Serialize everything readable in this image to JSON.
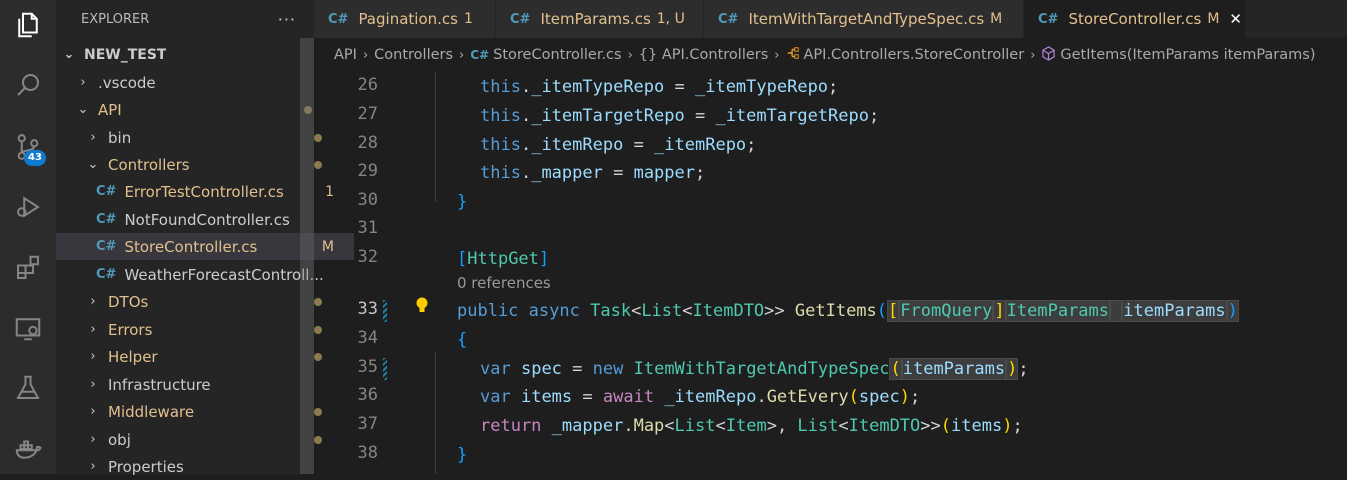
{
  "activity_bar": {
    "items": [
      {
        "name": "explorer",
        "icon": "files-icon"
      },
      {
        "name": "search",
        "icon": "search-icon"
      },
      {
        "name": "source-control",
        "icon": "source-control-icon",
        "badge": "43"
      },
      {
        "name": "run-debug",
        "icon": "debug-icon"
      },
      {
        "name": "extensions",
        "icon": "extensions-icon"
      },
      {
        "name": "remote-explorer",
        "icon": "remote-icon"
      },
      {
        "name": "testing",
        "icon": "flask-icon"
      },
      {
        "name": "docker",
        "icon": "docker-icon"
      }
    ]
  },
  "sidebar": {
    "title": "EXPLORER",
    "more": "···",
    "root": "NEW_TEST",
    "items": [
      {
        "label": ".vscode",
        "indent": 1,
        "type": "folder",
        "expanded": false
      },
      {
        "label": "API",
        "indent": 1,
        "type": "folder",
        "expanded": true,
        "modified": true
      },
      {
        "label": "bin",
        "indent": 2,
        "type": "folder",
        "expanded": false,
        "dot": true
      },
      {
        "label": "Controllers",
        "indent": 2,
        "type": "folder",
        "expanded": true,
        "modified": true
      },
      {
        "label": "ErrorTestController.cs",
        "indent": 3,
        "type": "file",
        "modified": true,
        "status": "1"
      },
      {
        "label": "NotFoundController.cs",
        "indent": 3,
        "type": "file"
      },
      {
        "label": "StoreController.cs",
        "indent": 3,
        "type": "file",
        "modified": true,
        "status": "M",
        "selected": true
      },
      {
        "label": "WeatherForecastControll...",
        "indent": 3,
        "type": "file"
      },
      {
        "label": "DTOs",
        "indent": 2,
        "type": "folder",
        "expanded": false,
        "modified": true
      },
      {
        "label": "Errors",
        "indent": 2,
        "type": "folder",
        "expanded": false,
        "modified": true
      },
      {
        "label": "Helper",
        "indent": 2,
        "type": "folder",
        "expanded": false,
        "modified": true
      },
      {
        "label": "Infrastructure",
        "indent": 2,
        "type": "folder",
        "expanded": false
      },
      {
        "label": "Middleware",
        "indent": 2,
        "type": "folder",
        "expanded": false,
        "modified": true
      },
      {
        "label": "obj",
        "indent": 2,
        "type": "folder",
        "expanded": false,
        "dot": true
      },
      {
        "label": "Properties",
        "indent": 2,
        "type": "folder",
        "expanded": false
      }
    ]
  },
  "tabs": [
    {
      "label": "Pagination.cs",
      "status": "1",
      "active": false
    },
    {
      "label": "ItemParams.cs",
      "status": "1, U",
      "active": false
    },
    {
      "label": "ItemWithTargetAndTypeSpec.cs",
      "status": "M",
      "active": false
    },
    {
      "label": "StoreController.cs",
      "status": "M",
      "active": true,
      "close": "✕"
    }
  ],
  "breadcrumbs": [
    "API",
    "Controllers",
    "StoreController.cs",
    "{} API.Controllers",
    "API.Controllers.StoreController",
    "GetItems(ItemParams itemParams)"
  ],
  "editor": {
    "line_numbers": [
      "26",
      "27",
      "28",
      "29",
      "30",
      "31",
      "32",
      "33",
      "34",
      "35",
      "36",
      "37",
      "38"
    ],
    "codelens": "0 references",
    "lines": [
      {
        "n": "26",
        "tokens": [
          [
            "k",
            "this"
          ],
          [
            "p",
            "."
          ],
          [
            "v",
            "_itemTypeRepo"
          ],
          [
            "p",
            " = "
          ],
          [
            "v",
            "_itemTypeRepo"
          ],
          [
            "p",
            ";"
          ]
        ]
      },
      {
        "n": "27",
        "tokens": [
          [
            "k",
            "this"
          ],
          [
            "p",
            "."
          ],
          [
            "v",
            "_itemTargetRepo"
          ],
          [
            "p",
            " = "
          ],
          [
            "v",
            "_itemTargetRepo"
          ],
          [
            "p",
            ";"
          ]
        ]
      },
      {
        "n": "28",
        "tokens": [
          [
            "k",
            "this"
          ],
          [
            "p",
            "."
          ],
          [
            "v",
            "_itemRepo"
          ],
          [
            "p",
            " = "
          ],
          [
            "v",
            "_itemRepo"
          ],
          [
            "p",
            ";"
          ]
        ]
      },
      {
        "n": "29",
        "tokens": [
          [
            "k",
            "this"
          ],
          [
            "p",
            "."
          ],
          [
            "v",
            "_mapper"
          ],
          [
            "p",
            " = "
          ],
          [
            "v",
            "mapper"
          ],
          [
            "p",
            ";"
          ]
        ]
      },
      {
        "n": "30",
        "tokens": [
          [
            "b3",
            "}"
          ]
        ]
      },
      {
        "n": "31",
        "tokens": []
      },
      {
        "n": "32",
        "tokens": [
          [
            "b3",
            "["
          ],
          [
            "t",
            "HttpGet"
          ],
          [
            "b3",
            "]"
          ]
        ]
      },
      {
        "n": "33",
        "tokens": [
          [
            "k",
            "public"
          ],
          [
            "p",
            " "
          ],
          [
            "k",
            "async"
          ],
          [
            "p",
            " "
          ],
          [
            "t",
            "Task"
          ],
          [
            "p",
            "<"
          ],
          [
            "t",
            "List"
          ],
          [
            "p",
            "<"
          ],
          [
            "t",
            "ItemDTO"
          ],
          [
            "p",
            ">> "
          ],
          [
            "f",
            "GetItems"
          ],
          [
            "b3",
            "("
          ],
          [
            "b1",
            "["
          ],
          [
            "t",
            "FromQuery"
          ],
          [
            "b1",
            "]"
          ],
          [
            "t",
            "ItemParams"
          ],
          [
            "p",
            " "
          ],
          [
            "v",
            "itemParams"
          ],
          [
            "b3",
            ")"
          ]
        ]
      },
      {
        "n": "34",
        "tokens": [
          [
            "b3",
            "{"
          ]
        ]
      },
      {
        "n": "35",
        "tokens": [
          [
            "k",
            "var"
          ],
          [
            "p",
            " "
          ],
          [
            "v",
            "spec"
          ],
          [
            "p",
            " = "
          ],
          [
            "k",
            "new"
          ],
          [
            "p",
            " "
          ],
          [
            "t",
            "ItemWithTargetAndTypeSpec"
          ],
          [
            "b1",
            "("
          ],
          [
            "v",
            "itemParams"
          ],
          [
            "b1",
            ")"
          ],
          [
            "p",
            ";"
          ]
        ]
      },
      {
        "n": "36",
        "tokens": [
          [
            "k",
            "var"
          ],
          [
            "p",
            " "
          ],
          [
            "v",
            "items"
          ],
          [
            "p",
            " = "
          ],
          [
            "c",
            "await"
          ],
          [
            "p",
            " "
          ],
          [
            "v",
            "_itemRepo"
          ],
          [
            "p",
            "."
          ],
          [
            "f",
            "GetEvery"
          ],
          [
            "b1",
            "("
          ],
          [
            "v",
            "spec"
          ],
          [
            "b1",
            ")"
          ],
          [
            "p",
            ";"
          ]
        ]
      },
      {
        "n": "37",
        "tokens": [
          [
            "c",
            "return"
          ],
          [
            "p",
            " "
          ],
          [
            "v",
            "_mapper"
          ],
          [
            "p",
            "."
          ],
          [
            "f",
            "Map"
          ],
          [
            "p",
            "<"
          ],
          [
            "t",
            "List"
          ],
          [
            "p",
            "<"
          ],
          [
            "t",
            "Item"
          ],
          [
            "p",
            ">, "
          ],
          [
            "t",
            "List"
          ],
          [
            "p",
            "<"
          ],
          [
            "t",
            "ItemDTO"
          ],
          [
            "p",
            ">>"
          ],
          [
            "b1",
            "("
          ],
          [
            "v",
            "items"
          ],
          [
            "b1",
            ")"
          ],
          [
            "p",
            ";"
          ]
        ]
      },
      {
        "n": "38",
        "tokens": [
          [
            "b3",
            "}"
          ]
        ]
      }
    ]
  }
}
